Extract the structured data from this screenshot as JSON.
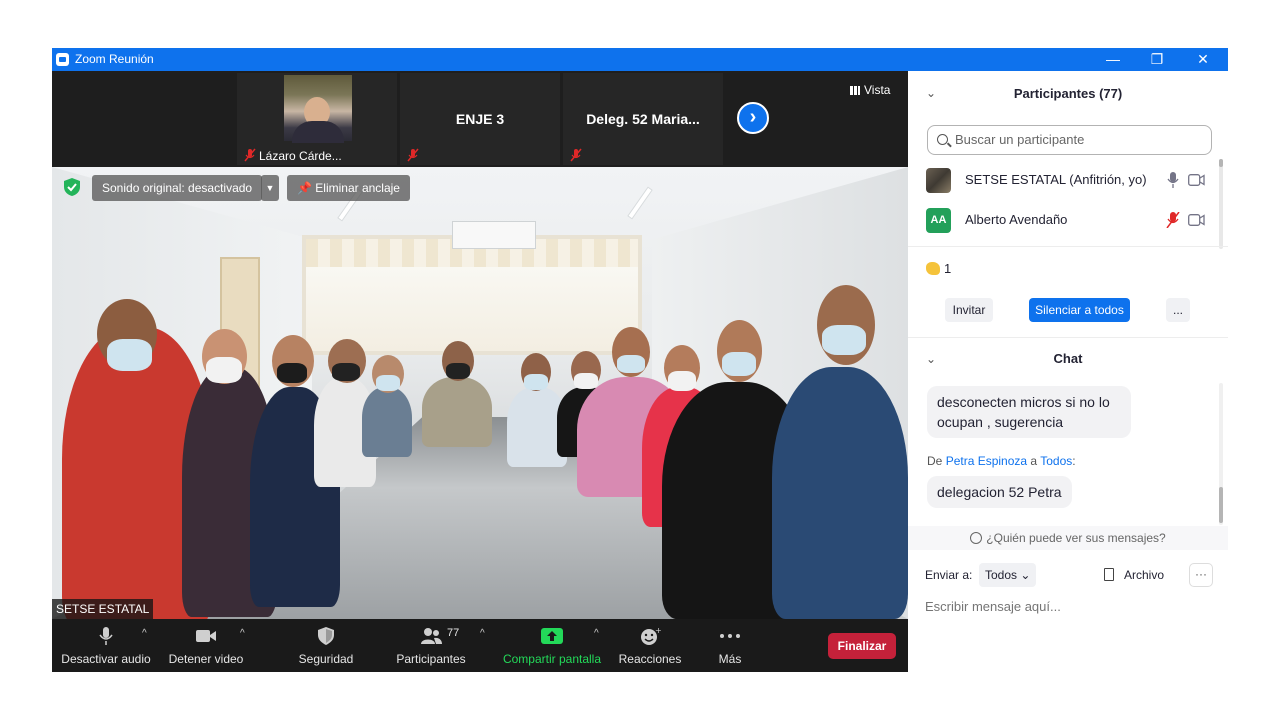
{
  "window": {
    "title": "Zoom Reunión",
    "minimize": "—",
    "restore": "❐",
    "close": "✕"
  },
  "thumbnails": [
    {
      "label": "Lázaro Cárde..."
    },
    {
      "name": "ENJE 3"
    },
    {
      "name": "Deleg. 52 Maria..."
    }
  ],
  "view_label": "Vista",
  "main_video": {
    "speaker_name": "SETSE ESTATAL",
    "sound_label": "Sonido original: desactivado",
    "unpin_label": "Eliminar anclaje"
  },
  "toolbar": {
    "mute": "Desactivar audio",
    "video": "Detener video",
    "security": "Seguridad",
    "participants": "Participantes",
    "participant_count": "77",
    "share": "Compartir pantalla",
    "reactions": "Reacciones",
    "more": "Más",
    "end": "Finalizar"
  },
  "participants_panel": {
    "title": "Participantes (77)",
    "search_placeholder": "Buscar un participante",
    "list": [
      {
        "name": "SETSE ESTATAL (Anfitrión, yo)",
        "initials": ""
      },
      {
        "name": "Alberto Avendaño",
        "initials": "AA"
      }
    ],
    "reaction_count": "1",
    "invite": "Invitar",
    "mute_all": "Silenciar a todos",
    "more": "..."
  },
  "chat": {
    "title": "Chat",
    "messages": [
      {
        "text": "desconecten micros si no lo ocupan , sugerencia"
      },
      {
        "text": "delegacion 52 Petra"
      }
    ],
    "from_prefix": "De",
    "from_name": "Petra Espinoza",
    "from_mid": "a",
    "from_to": "Todos",
    "from_suffix": ":",
    "who_sees": "¿Quién puede ver sus mensajes?",
    "send_to_label": "Enviar a:",
    "send_to_value": "Todos",
    "file_label": "Archivo",
    "more": "···",
    "input_placeholder": "Escribir mensaje aquí..."
  }
}
